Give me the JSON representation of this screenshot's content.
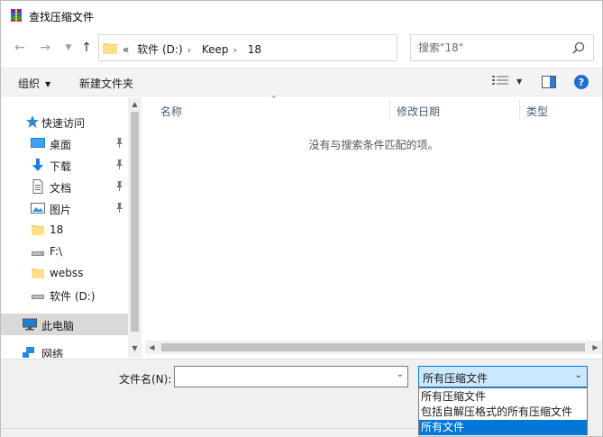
{
  "window": {
    "title": "查找压缩文件"
  },
  "nav": {
    "breadcrumb": [
      "«",
      "软件 (D:)",
      "Keep",
      "18"
    ],
    "search_placeholder": "搜索\"18\""
  },
  "toolbar": {
    "organize_label": "组织",
    "new_folder_label": "新建文件夹"
  },
  "sidebar": {
    "items": [
      {
        "label": "快速访问",
        "icon": "star-icon",
        "pinned": false
      },
      {
        "label": "桌面",
        "icon": "desktop-icon",
        "pinned": true
      },
      {
        "label": "下载",
        "icon": "download-icon",
        "pinned": true
      },
      {
        "label": "文档",
        "icon": "document-icon",
        "pinned": true
      },
      {
        "label": "图片",
        "icon": "pictures-icon",
        "pinned": true
      },
      {
        "label": "18",
        "icon": "folder-icon",
        "pinned": false
      },
      {
        "label": "F:\\",
        "icon": "drive-icon",
        "pinned": false
      },
      {
        "label": "webss",
        "icon": "folder-icon",
        "pinned": false
      },
      {
        "label": "软件 (D:)",
        "icon": "drive-icon",
        "pinned": false
      },
      {
        "label": "此电脑",
        "icon": "computer-icon",
        "pinned": false
      },
      {
        "label": "网络",
        "icon": "network-icon",
        "pinned": false
      }
    ]
  },
  "content": {
    "columns": [
      "名称",
      "修改日期",
      "类型"
    ],
    "empty_message": "没有与搜索条件匹配的项。"
  },
  "bottom": {
    "filename_label": "文件名(N):",
    "filename_value": "",
    "filetype_value": "所有压缩文件",
    "filetype_options": [
      "所有压缩文件",
      "包括自解压格式的所有压缩文件",
      "所有文件"
    ],
    "filetype_highlighted": "所有文件"
  },
  "colors": {
    "accent": "#0078d7",
    "select_bg": "#cce8ff",
    "nav_selected": "#d9d9d9",
    "help": "#1e6fd0"
  }
}
